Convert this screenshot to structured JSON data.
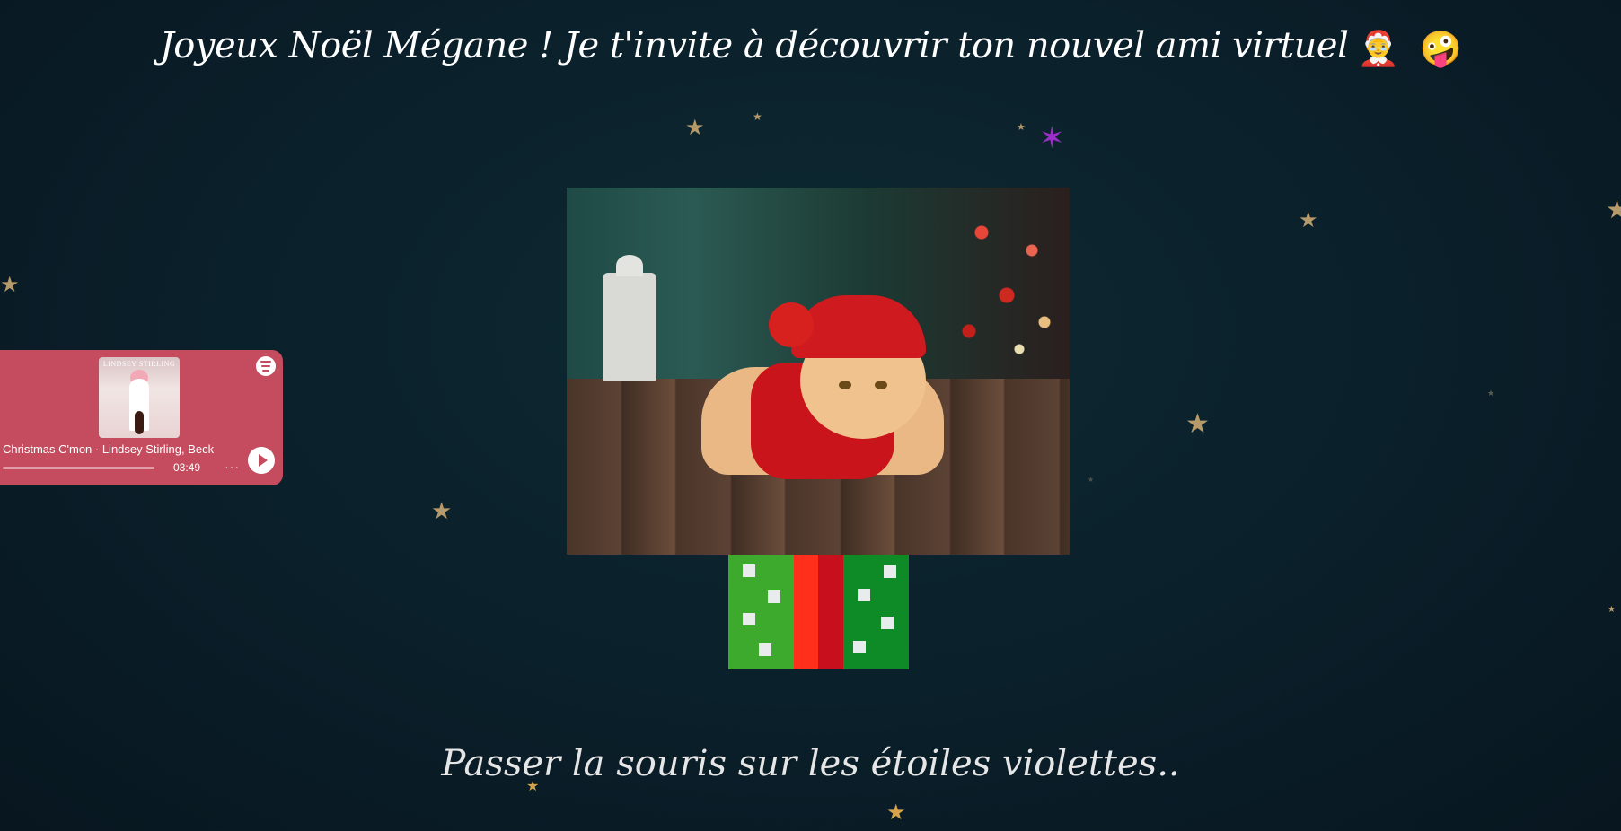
{
  "header": {
    "title": "Joyeux Noël Mégane ! Je t'invite à découvrir ton nouvel ami virtuel",
    "emoji_1": "🤶",
    "emoji_2": "🤪"
  },
  "hint": {
    "text": "Passer la souris sur les étoiles violettes.."
  },
  "player": {
    "track": "Christmas C'mon · Lindsey Stirling, Beck",
    "duration": "03:49",
    "more_label": "···",
    "cover_text": "LINDSEY STIRLING",
    "progress_fraction": 0.0
  },
  "icons": {
    "star": "★",
    "purple_star": "✶",
    "spotify": "spotify-icon",
    "play": "play-icon"
  },
  "colors": {
    "background": "#0a1f2a",
    "star_gold": "#b79a6a",
    "star_purple": "#9b2fc8",
    "player_bg": "#c44c5e",
    "gift_light_green": "#3eaa2d",
    "gift_dark_green": "#0e8a27",
    "gift_red": "#ff2f1c",
    "gift_dark_red": "#c80f1e"
  }
}
